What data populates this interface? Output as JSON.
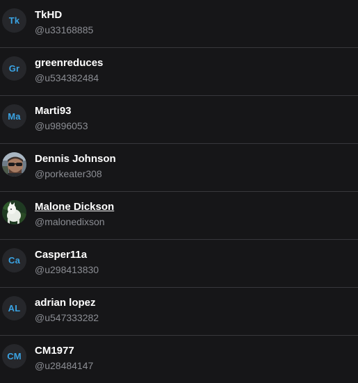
{
  "users": [
    {
      "avatar": {
        "type": "initials",
        "text": "Tk"
      },
      "name": "TkHD",
      "handle": "@u33168885"
    },
    {
      "avatar": {
        "type": "initials",
        "text": "Gr"
      },
      "name": "greenreduces",
      "handle": "@u534382484"
    },
    {
      "avatar": {
        "type": "initials",
        "text": "Ma"
      },
      "name": "Marti93",
      "handle": "@u9896053"
    },
    {
      "avatar": {
        "type": "photo",
        "icon": "person-sunglasses-photo"
      },
      "name": "Dennis Johnson",
      "handle": "@porkeater308"
    },
    {
      "avatar": {
        "type": "photo",
        "icon": "white-animal-photo"
      },
      "name": "Malone Dickson",
      "handle": "@malonedixson",
      "hovered": true
    },
    {
      "avatar": {
        "type": "initials",
        "text": "Ca"
      },
      "name": "Casper11a",
      "handle": "@u298413830"
    },
    {
      "avatar": {
        "type": "initials",
        "text": "AL"
      },
      "name": "adrian lopez",
      "handle": "@u547333282"
    },
    {
      "avatar": {
        "type": "initials",
        "text": "CM"
      },
      "name": "CM1977",
      "handle": "@u28484147"
    }
  ],
  "colors": {
    "background": "#161618",
    "divider": "#38383c",
    "initials": "#3aa3e3",
    "name": "#ffffff",
    "handle": "#8b8d93"
  }
}
